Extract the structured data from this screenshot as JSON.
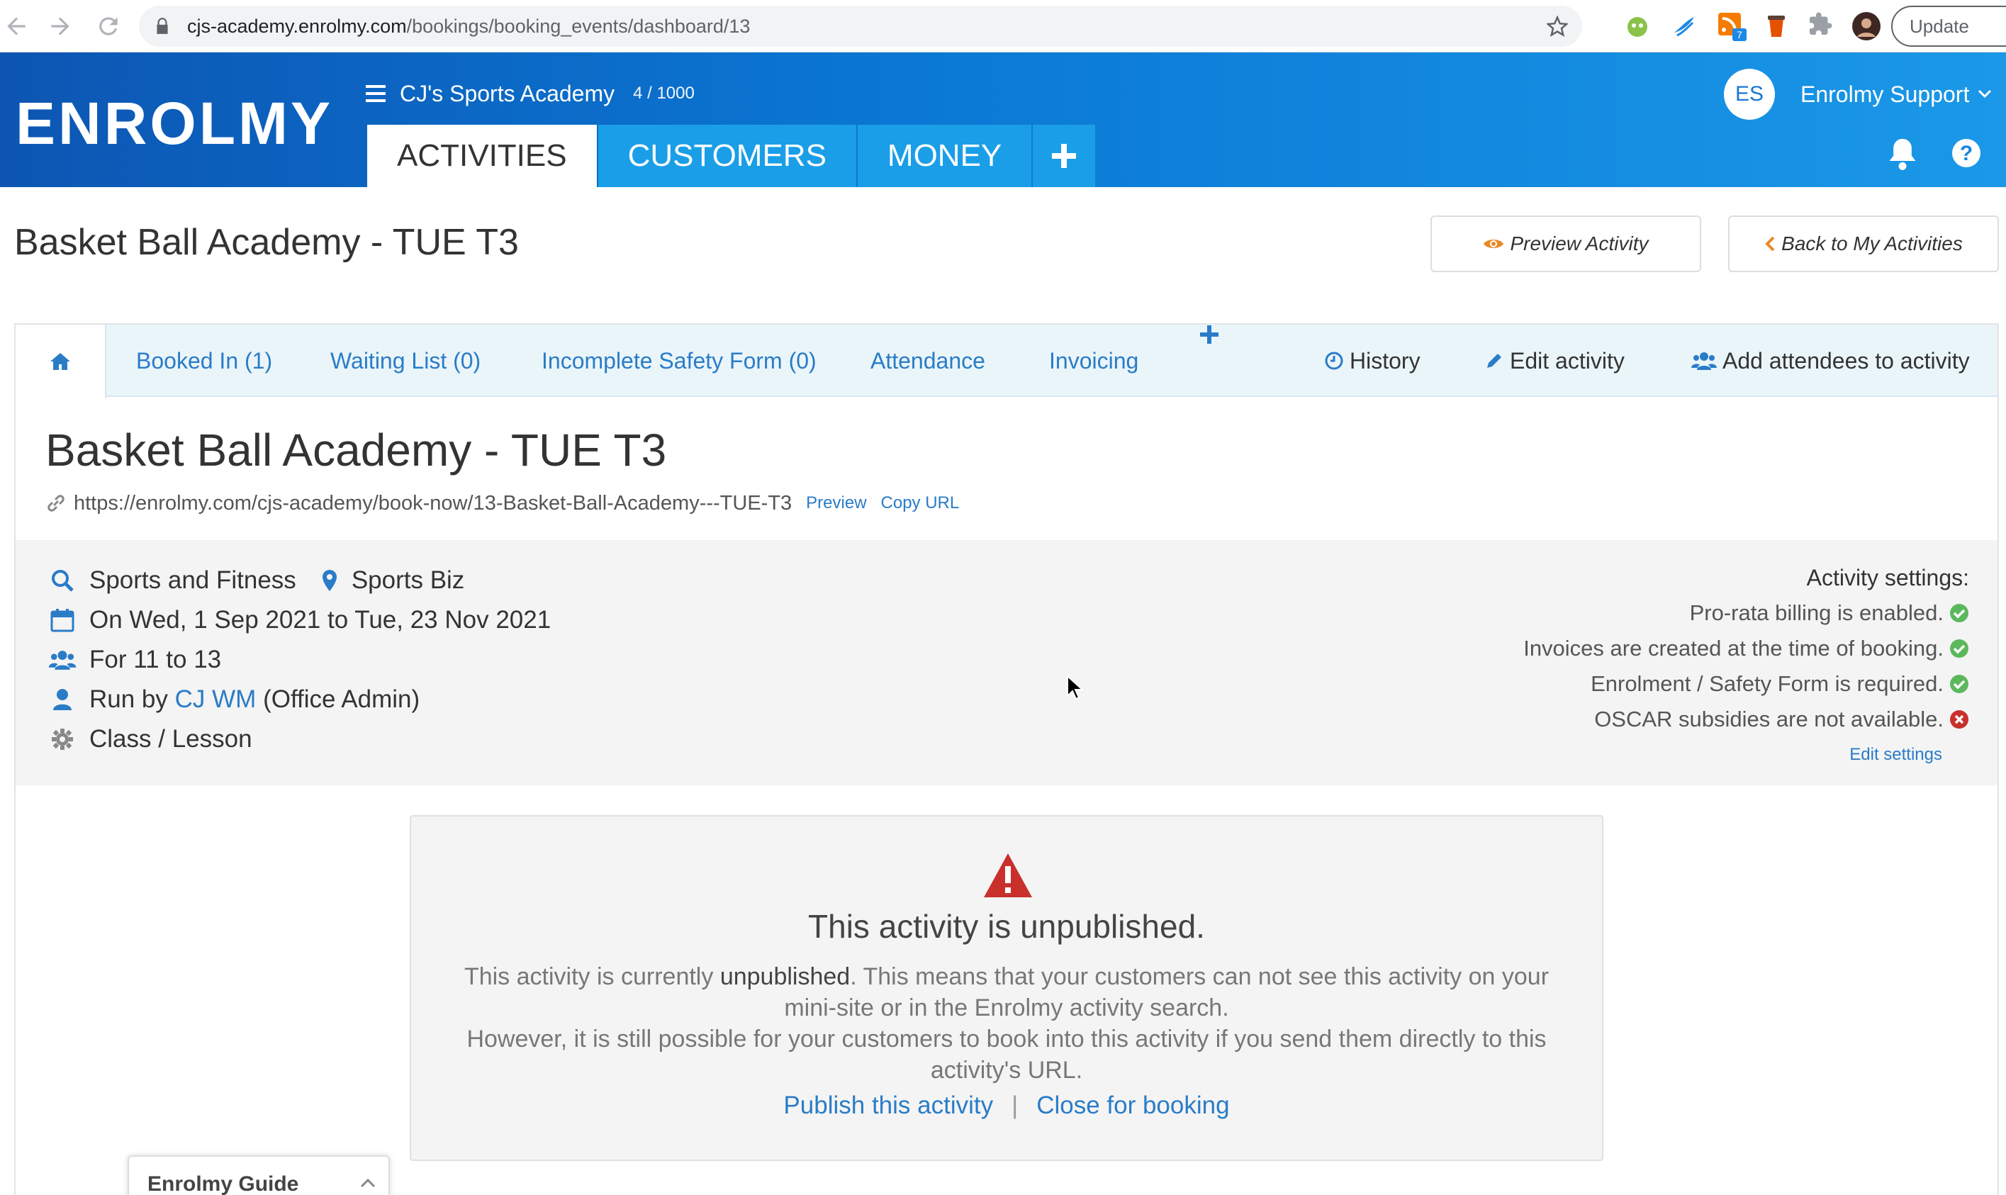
{
  "browser": {
    "url_host": "cjs-academy.enrolmy.com",
    "url_path": "/bookings/booking_events/dashboard/13",
    "update_label": "Update"
  },
  "header": {
    "logo": "ENROLMY",
    "org_name": "CJ's Sports Academy",
    "org_count": "4 / 1000",
    "tabs": [
      {
        "label": "ACTIVITIES"
      },
      {
        "label": "CUSTOMERS"
      },
      {
        "label": "MONEY"
      }
    ],
    "user_initials": "ES",
    "user_name": "Enrolmy Support"
  },
  "page": {
    "title": "Basket Ball Academy - TUE T3",
    "preview_btn": "Preview Activity",
    "back_btn": "Back to My Activities"
  },
  "subnav": {
    "booked_in": "Booked In (1)",
    "waiting_list": "Waiting List (0)",
    "incomplete_safety": "Incomplete Safety Form (0)",
    "attendance": "Attendance",
    "invoicing": "Invoicing",
    "history": "History",
    "edit_activity": "Edit activity",
    "add_attendees": "Add attendees to activity"
  },
  "activity": {
    "title": "Basket Ball Academy - TUE T3",
    "url": "https://enrolmy.com/cjs-academy/book-now/13-Basket-Ball-Academy---TUE-T3",
    "preview_link": "Preview",
    "copy_link": "Copy URL",
    "category": "Sports and Fitness",
    "location": "Sports Biz",
    "dates": "On Wed, 1 Sep 2021 to Tue, 23 Nov 2021",
    "ages": "For 11 to 13",
    "run_by_prefix": "Run by",
    "run_by_name": "CJ WM",
    "run_by_role": "(Office Admin)",
    "type": "Class / Lesson"
  },
  "settings": {
    "heading": "Activity settings:",
    "items": [
      {
        "text": "Pro-rata billing is enabled.",
        "status": "ok"
      },
      {
        "text": "Invoices are created at the time of booking.",
        "status": "ok"
      },
      {
        "text": "Enrolment / Safety Form is required.",
        "status": "ok"
      },
      {
        "text": "OSCAR subsidies are not available.",
        "status": "no"
      }
    ],
    "edit_link": "Edit settings"
  },
  "notice": {
    "title": "This activity is unpublished.",
    "line1_pre": "This activity is currently",
    "line1_em": "unpublished",
    "line1_post": ". This means that your customers can not see this activity on your mini-site or in the Enrolmy activity search.",
    "line2": "However, it is still possible for your customers to book into this activity if you send them directly to this activity's URL.",
    "publish_link": "Publish this activity",
    "separator": "|",
    "close_link": "Close for booking"
  },
  "guide": {
    "title": "Enrolmy Guide"
  },
  "colors": {
    "brand_blue": "#0a78d4",
    "tab_blue": "#1a9ee8",
    "link": "#2a7cc7",
    "ok_green": "#5cb85c",
    "error_red": "#c9302c",
    "preview_orange": "#e8892a"
  }
}
